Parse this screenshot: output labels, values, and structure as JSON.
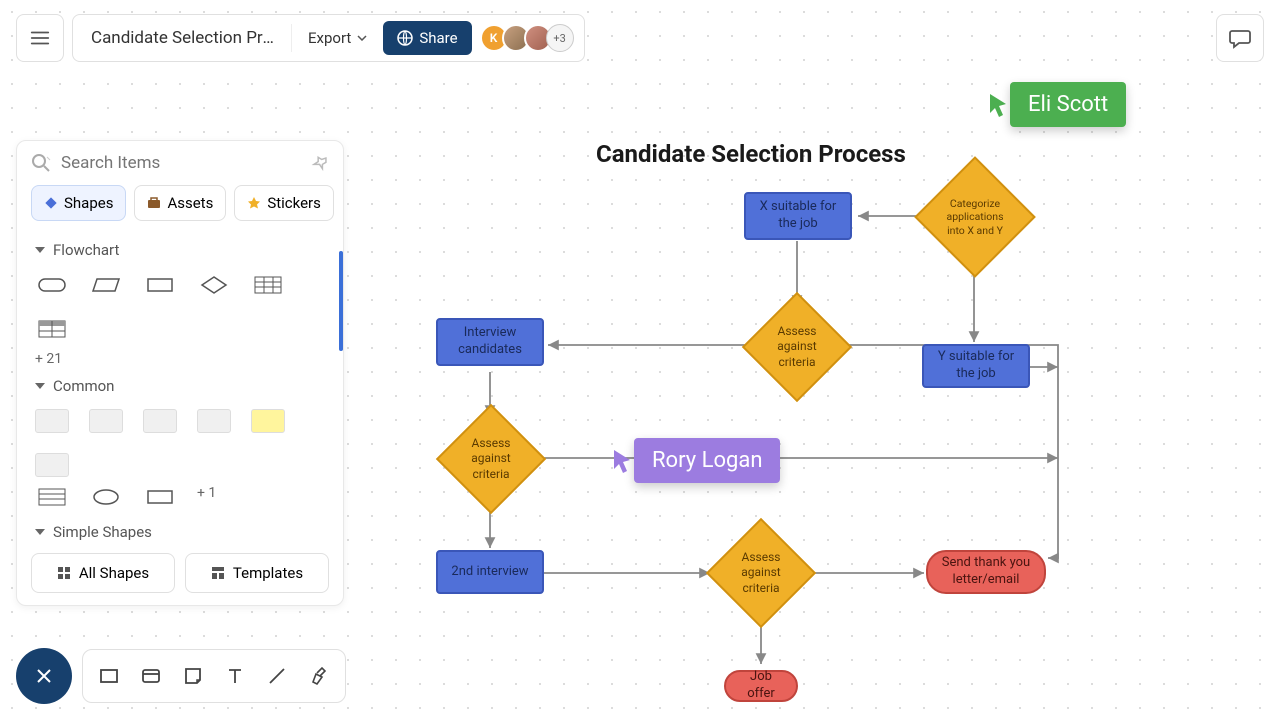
{
  "doc": {
    "title": "Candidate Selection Pro..."
  },
  "toolbar": {
    "export_label": "Export",
    "share_label": "Share",
    "avatar_initial": "K",
    "avatar_more": "+3"
  },
  "panel": {
    "search_placeholder": "Search Items",
    "tabs": {
      "shapes": "Shapes",
      "assets": "Assets",
      "stickers": "Stickers"
    },
    "sections": {
      "flowchart": "Flowchart",
      "flowchart_more": "+ 21",
      "common": "Common",
      "common_more": "+ 1",
      "simple": "Simple Shapes"
    },
    "buttons": {
      "all_shapes": "All Shapes",
      "templates": "Templates"
    }
  },
  "flow": {
    "title": "Candidate Selection Process",
    "nodes": {
      "x_suitable": "X suitable for the job",
      "categorize": "Categorize applications into X and Y",
      "interview": "Interview candidates",
      "assess1": "Assess against criteria",
      "y_suitable": "Y suitable for the job",
      "assess2": "Assess against criteria",
      "second": "2nd interview",
      "assess3": "Assess against criteria",
      "thankyou": "Send thank you letter/email",
      "offer": "Job offer"
    }
  },
  "cursors": {
    "eli": "Eli Scott",
    "rory": "Rory Logan"
  },
  "colors": {
    "brand": "#17406d",
    "process": "#5070d8",
    "decision": "#f0b028",
    "terminal": "#e8625a",
    "cursor_green": "#4caf50",
    "cursor_purple": "#9c7ce0"
  }
}
